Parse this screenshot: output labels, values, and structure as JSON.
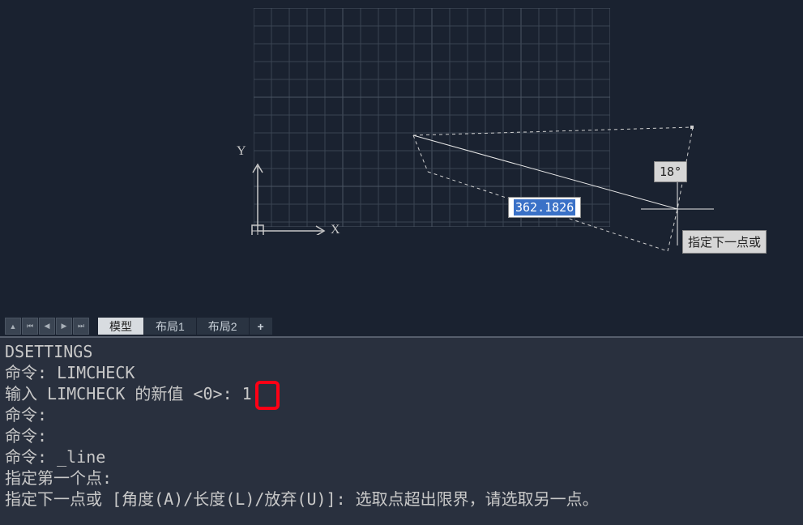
{
  "axis": {
    "y": "Y",
    "x": "X"
  },
  "dynamic": {
    "length": "362.1826",
    "angle": "18°",
    "prompt": "指定下一点或"
  },
  "tabs": {
    "model": "模型",
    "layout1": "布局1",
    "layout2": "布局2",
    "plus": "+"
  },
  "nav": {
    "up": "▲",
    "first": "⏮",
    "prev": "◀",
    "next": "▶",
    "last": "⏭"
  },
  "cmd": {
    "l1": "DSETTINGS",
    "l2": "命令: LIMCHECK",
    "l3": "输入 LIMCHECK 的新值 <0>: 1",
    "l4": "命令:",
    "l5": "命令:",
    "l6": "命令: _line",
    "l7": "指定第一个点:",
    "l8": "指定下一点或 [角度(A)/长度(L)/放弃(U)]: 选取点超出限界，请选取另一点。"
  }
}
